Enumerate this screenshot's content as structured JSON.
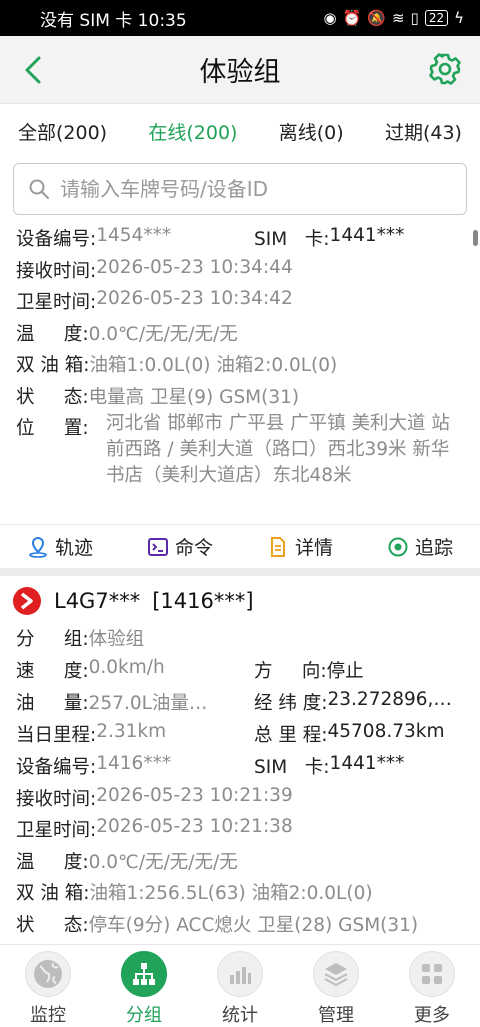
{
  "status_bar": {
    "carrier_time": "没有 SIM 卡 10:35",
    "battery": "22"
  },
  "header": {
    "title": "体验组"
  },
  "tabs": [
    {
      "label": "全部(200)",
      "active": false
    },
    {
      "label": "在线(200)",
      "active": true
    },
    {
      "label": "离线(0)",
      "active": false
    },
    {
      "label": "过期(43)",
      "active": false
    }
  ],
  "search": {
    "placeholder": "请输入车牌号码/设备ID"
  },
  "card1": {
    "device_no_label": "设备编号:",
    "device_no": "1454***",
    "sim_label": "SIM   卡:",
    "sim": "1441***",
    "recv_label": "接收时间:",
    "recv": "2026-05-23 10:34:44",
    "sat_label": "卫星时间:",
    "sat": "2026-05-23 10:34:42",
    "temp_label": "温     度:",
    "temp": "0.0℃/无/无/无/无",
    "oil_label": "双 油 箱:",
    "oil": "油箱1:0.0L(0) 油箱2:0.0L(0)",
    "state_label": "状     态:",
    "state": "电量高 卫星(9) GSM(31)",
    "pos_label": "位     置:",
    "pos": "河北省 邯郸市 广平县 广平镇 美利大道 站前西路 / 美利大道（路口）西北39米 新华书店（美利大道店）东北48米"
  },
  "actions": {
    "track": "轨迹",
    "command": "命令",
    "detail": "详情",
    "trace": "追踪"
  },
  "card2": {
    "plate": "L4G7***",
    "device": "[1416***]",
    "group_label": "分     组:",
    "group": "体验组",
    "speed_label": "速     度:",
    "speed": "0.0km/h",
    "dir_label": "方     向:",
    "dir": "停止",
    "oil_label": "油     量:",
    "oil": "257.0L油量…",
    "lnglat_label": "经 纬 度:",
    "lnglat": "23.272896,…",
    "day_label": "当日里程:",
    "day": "2.31km",
    "total_label": "总 里 程:",
    "total": "45708.73km",
    "device_no_label": "设备编号:",
    "device_no": "1416***",
    "sim_label": "SIM   卡:",
    "sim": "1441***",
    "recv_label": "接收时间:",
    "recv": "2026-05-23 10:21:39",
    "sat_label": "卫星时间:",
    "sat": "2026-05-23 10:21:38",
    "temp_label": "温     度:",
    "temp": "0.0℃/无/无/无/无",
    "oil2_label": "双 油 箱:",
    "oil2": "油箱1:256.5L(63) 油箱2:0.0L(0)",
    "state_label": "状     态:",
    "state": "停车(9分) ACC熄火 卫星(28) GSM(31)"
  },
  "bottom_nav": [
    {
      "label": "监控",
      "icon": "globe-icon",
      "active": false
    },
    {
      "label": "分组",
      "icon": "org-chart-icon",
      "active": true
    },
    {
      "label": "统计",
      "icon": "bar-chart-icon",
      "active": false
    },
    {
      "label": "管理",
      "icon": "layers-icon",
      "active": false
    },
    {
      "label": "更多",
      "icon": "grid-icon",
      "active": false
    }
  ],
  "colors": {
    "accent": "#21a35a",
    "value_text": "#8c8c8c",
    "badge_red": "#e02020"
  }
}
